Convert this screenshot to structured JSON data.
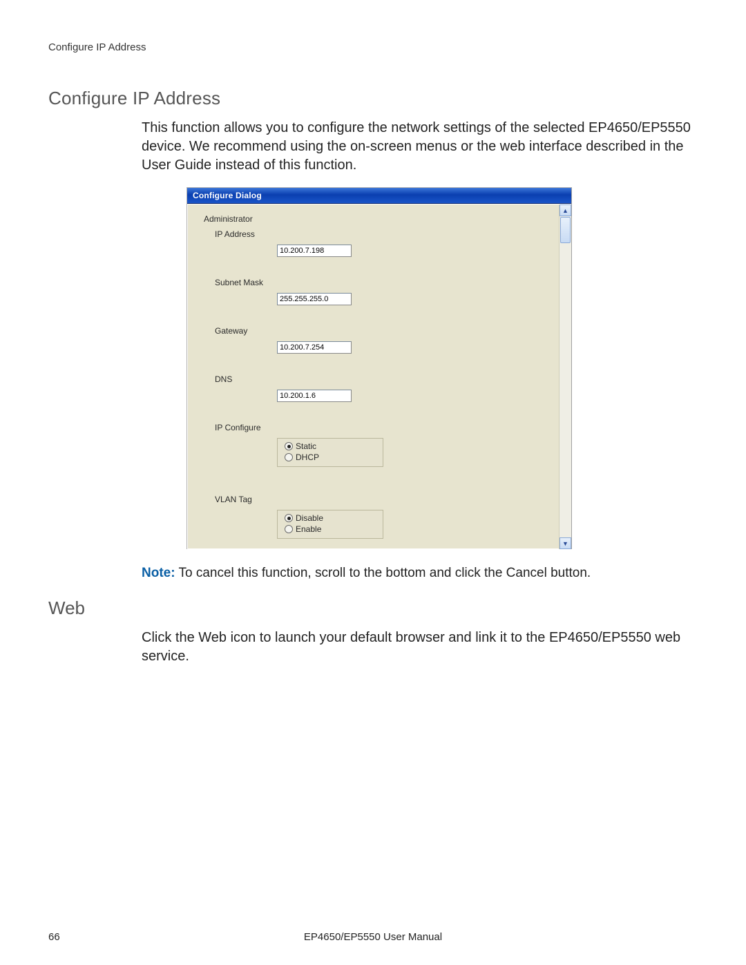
{
  "runningHeader": "Configure IP Address",
  "section1": {
    "title": "Configure IP Address",
    "body": "This function allows you to configure the network settings of the selected EP4650/EP5550 device. We recommend using the on-screen menus or the web interface described in the User Guide instead of this function."
  },
  "dialog": {
    "title": "Configure Dialog",
    "adminLabel": "Administrator",
    "fields": {
      "ipAddress": {
        "label": "IP Address",
        "value": "10.200.7.198"
      },
      "subnetMask": {
        "label": "Subnet Mask",
        "value": "255.255.255.0"
      },
      "gateway": {
        "label": "Gateway",
        "value": "10.200.7.254"
      },
      "dns": {
        "label": "DNS",
        "value": "10.200.1.6"
      }
    },
    "ipConfigure": {
      "label": "IP Configure",
      "optionStatic": "Static",
      "optionDhcp": "DHCP",
      "selected": "Static"
    },
    "vlanTag": {
      "label": "VLAN Tag",
      "optionDisable": "Disable",
      "optionEnable": "Enable",
      "selected": "Disable"
    }
  },
  "note": {
    "label": "Note:",
    "text": " To cancel this function, scroll to the bottom and click the Cancel button."
  },
  "section2": {
    "title": "Web",
    "body": "Click the Web icon to launch your default browser and link it to the EP4650/EP5550 web service."
  },
  "footer": {
    "pageNumber": "66",
    "manual": "EP4650/EP5550 User Manual"
  }
}
